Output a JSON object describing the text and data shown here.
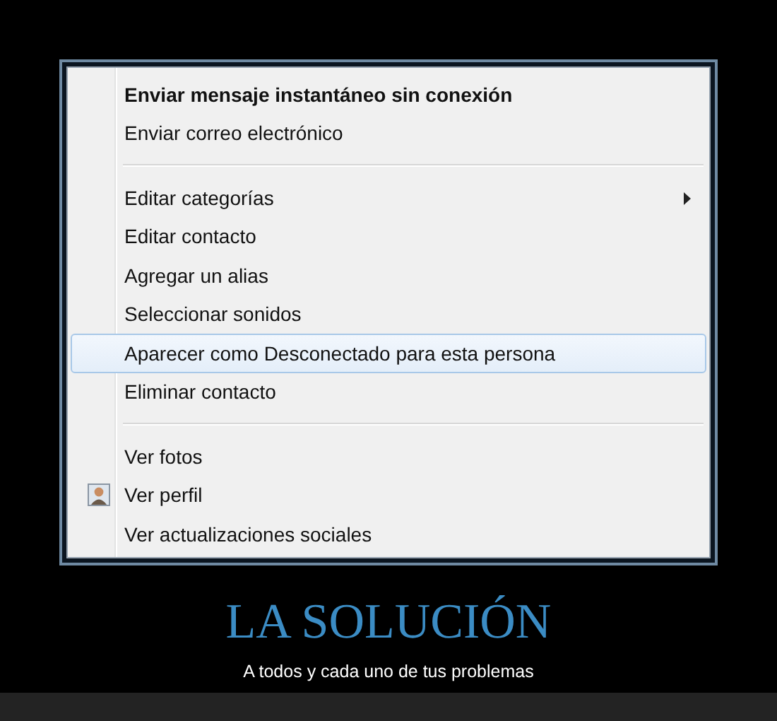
{
  "menu": {
    "groups": [
      [
        {
          "label": "Enviar mensaje instantáneo sin conexión",
          "default": true,
          "selected": false
        },
        {
          "label": "Enviar correo electrónico",
          "selected": false
        }
      ],
      [
        {
          "label": "Editar categorías",
          "submenu": true,
          "selected": false
        },
        {
          "label": "Editar contacto",
          "selected": false
        },
        {
          "label": "Agregar un alias",
          "selected": false
        },
        {
          "label": "Seleccionar sonidos",
          "selected": false
        },
        {
          "label": "Aparecer como Desconectado para esta persona",
          "selected": true
        },
        {
          "label": "Eliminar contacto",
          "selected": false
        }
      ],
      [
        {
          "label": "Ver fotos",
          "selected": false
        },
        {
          "label": "Ver perfil",
          "has_icon": true,
          "selected": false
        },
        {
          "label": "Ver actualizaciones sociales",
          "selected": false
        }
      ]
    ]
  },
  "caption": {
    "title": "LA SOLUCIÓN",
    "subtitle": "A todos y cada uno de tus problemas"
  }
}
